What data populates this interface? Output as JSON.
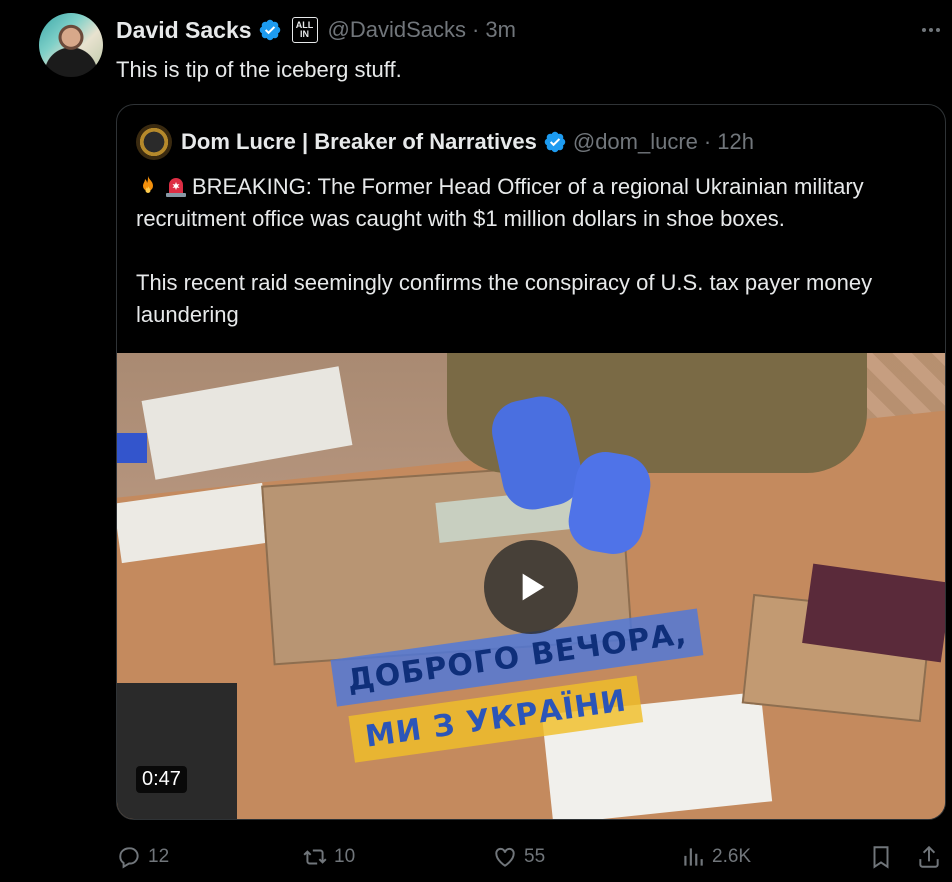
{
  "tweet": {
    "author_name": "David Sacks",
    "badge_text_line1": "ALL",
    "badge_text_line2": "IN",
    "handle": "@DavidSacks",
    "separator": "·",
    "time": "3m",
    "text": "This is tip of the iceberg stuff."
  },
  "quoted": {
    "author_name": "Dom Lucre | Breaker of Narratives",
    "handle": "@dom_lucre",
    "separator": "·",
    "time": "12h",
    "emojis": [
      "fire-emoji",
      "siren-emoji"
    ],
    "line1": "BREAKING: The Former Head Officer of a regional Ukrainian military",
    "line2": "recruitment office was caught with $1 million dollars in shoe boxes.",
    "line3": "This recent raid seemingly confirms the conspiracy of U.S. tax payer money",
    "line4": "laundering",
    "video": {
      "duration": "0:47",
      "banner_line1": "ДОБРОГО ВЕЧОРА,",
      "banner_line2": "МИ З УКРАЇНИ"
    }
  },
  "actions": {
    "replies": "12",
    "reposts": "10",
    "likes": "55",
    "views": "2.6K"
  },
  "colors": {
    "background": "#000000",
    "text": "#e7e9ea",
    "muted": "#71767b",
    "verified": "#1d9bf0",
    "border": "#2f3336"
  }
}
